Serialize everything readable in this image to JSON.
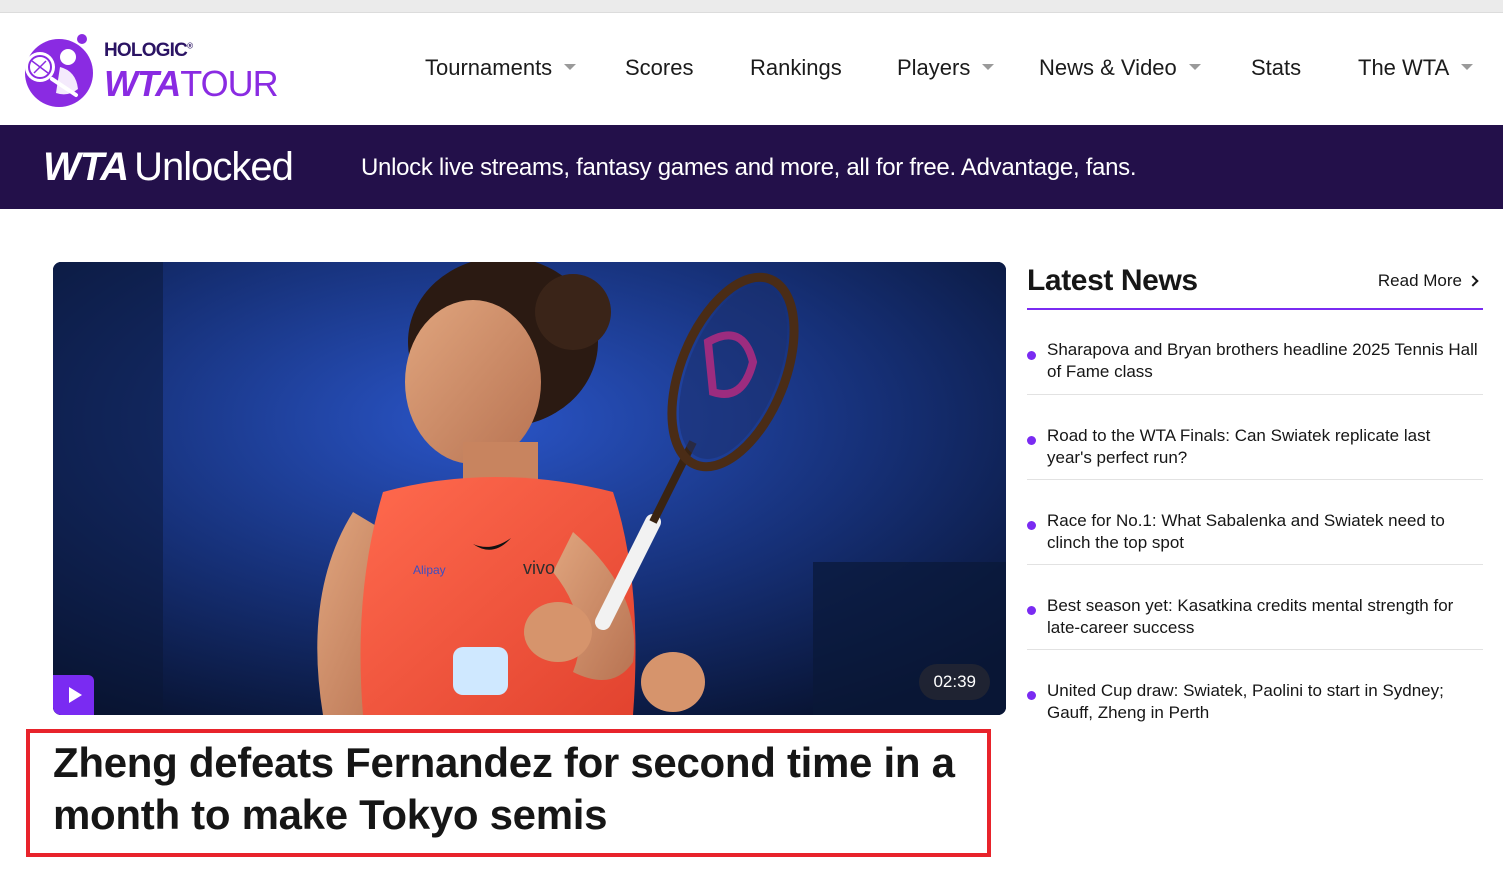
{
  "header": {
    "logo": {
      "brand": "HOLOGIC",
      "brand_mark": "®",
      "tour_bold": "WTA",
      "tour_light": "TOUR"
    },
    "nav": [
      {
        "label": "Tournaments",
        "dropdown": true
      },
      {
        "label": "Scores",
        "dropdown": false
      },
      {
        "label": "Rankings",
        "dropdown": false
      },
      {
        "label": "Players",
        "dropdown": true
      },
      {
        "label": "News & Video",
        "dropdown": true
      },
      {
        "label": "Stats",
        "dropdown": false
      },
      {
        "label": "The WTA",
        "dropdown": true
      }
    ]
  },
  "banner": {
    "logo_bold": "WTA",
    "logo_light": "Unlocked",
    "text": "Unlock live streams, fantasy games and more, all for free. Advantage, fans."
  },
  "hero": {
    "duration": "02:39",
    "headline": "Zheng defeats Fernandez for second time in a month to make Tokyo semis",
    "shirt_texts": [
      "Alipay",
      "vivo"
    ]
  },
  "latest_news": {
    "title": "Latest News",
    "read_more": "Read More",
    "items": [
      "Sharapova and Bryan brothers headline 2025 Tennis Hall of Fame class",
      "Road to the WTA Finals: Can Swiatek replicate last year's perfect run?",
      "Race for No.1: What Sabalenka and Swiatek need to clinch the top spot",
      "Best season yet: Kasatkina credits mental strength for late-career success",
      "United Cup draw: Swiatek, Paolini to start in Sydney; Gauff, Zheng in Perth"
    ]
  },
  "colors": {
    "accent": "#7a2bf2",
    "banner_bg": "#23104a",
    "logo_purple": "#8a2be2",
    "highlight_border": "#e8232b"
  }
}
